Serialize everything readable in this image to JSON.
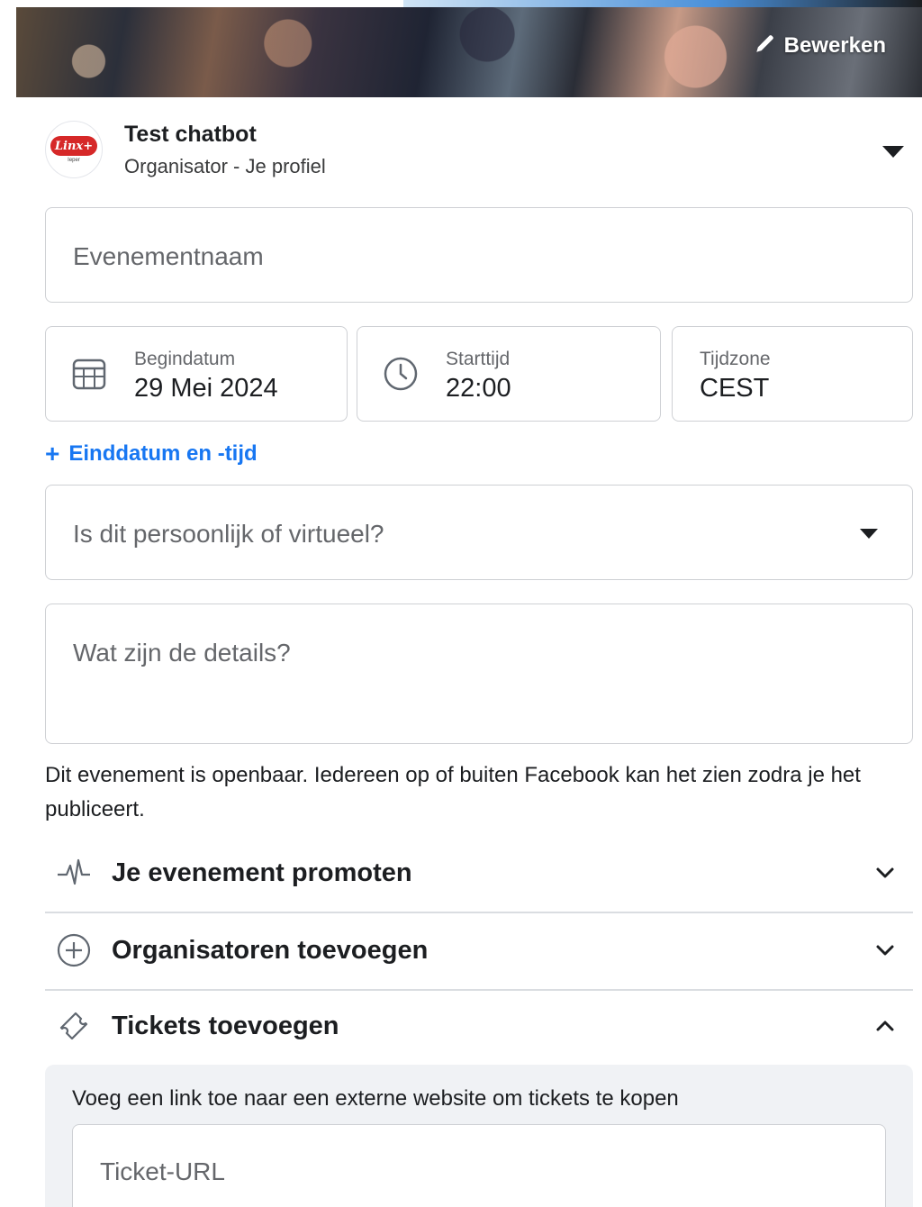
{
  "cover": {
    "edit_label": "Bewerken"
  },
  "organizer": {
    "logo_text": "Linx+",
    "logo_subtext": "Ieper",
    "name": "Test chatbot",
    "role": "Organisator - Je profiel"
  },
  "form": {
    "event_name_placeholder": "Evenementnaam",
    "start_date": {
      "label": "Begindatum",
      "value": "29 Mei 2024"
    },
    "start_time": {
      "label": "Starttijd",
      "value": "22:00"
    },
    "timezone": {
      "label": "Tijdzone",
      "value": "CEST"
    },
    "end_link": "Einddatum en -tijd",
    "location_placeholder": "Is dit persoonlijk of virtueel?",
    "details_placeholder": "Wat zijn de details?",
    "privacy_text": "Dit evenement is openbaar. Iedereen op of buiten Facebook kan het zien zodra je het publiceert."
  },
  "sections": {
    "promote": "Je evenement promoten",
    "organizers": "Organisatoren toevoegen",
    "tickets": "Tickets toevoegen"
  },
  "tickets": {
    "description": "Voeg een link toe naar een externe website om tickets te kopen",
    "url_placeholder": "Ticket-URL"
  },
  "colors": {
    "accent": "#1877f2",
    "border": "#ced0d4",
    "panel": "#f0f2f5"
  }
}
